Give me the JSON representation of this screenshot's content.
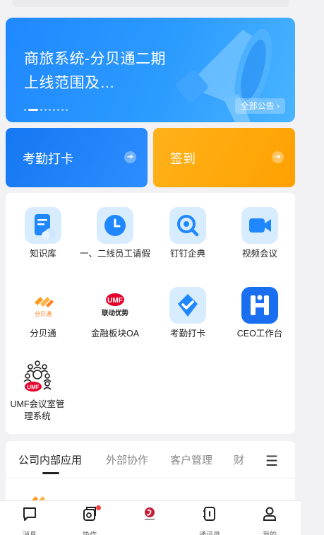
{
  "banner": {
    "title": "商旅系统-分贝通二期上线范围及…",
    "all_announcements": "全部公告 ›",
    "page_count": 9,
    "active_page": 1
  },
  "actions": {
    "checkin": "考勤打卡",
    "signin": "签到"
  },
  "apps": [
    {
      "label": "知识库",
      "icon": "document-icon"
    },
    {
      "label": "一、二线员工请假",
      "icon": "clock-icon"
    },
    {
      "label": "钉钉企典",
      "icon": "search-magnifier-icon"
    },
    {
      "label": "视频会议",
      "icon": "video-camera-icon"
    },
    {
      "label": "分贝通",
      "icon": "fenbeitong-logo-icon"
    },
    {
      "label": "金融板块OA",
      "icon": "umf-logo-icon"
    },
    {
      "label": "考勤打卡",
      "icon": "check-shield-icon"
    },
    {
      "label": "CEO工作台",
      "icon": "h-logo-icon"
    },
    {
      "label": "UMF会议室管理系统",
      "icon": "people-group-icon"
    }
  ],
  "umf_logo_text": "UMF",
  "umf_subtitle": "联动优势",
  "fenbei_logo_text": "分贝通",
  "tabs": [
    {
      "label": "公司内部应用",
      "active": true
    },
    {
      "label": "外部协作",
      "active": false
    },
    {
      "label": "客户管理",
      "active": false
    },
    {
      "label": "财",
      "active": false
    }
  ],
  "nav": [
    {
      "label": "消息",
      "icon": "chat-icon"
    },
    {
      "label": "协作",
      "icon": "collaboration-icon",
      "badge": true
    },
    {
      "label": "",
      "icon": "company-logo-icon"
    },
    {
      "label": "通讯录",
      "icon": "contacts-icon"
    },
    {
      "label": "我的",
      "icon": "person-icon"
    }
  ],
  "colors": {
    "brand_blue": "#1f88ff",
    "brand_orange": "#ffa000",
    "badge_red": "#f5413f"
  }
}
